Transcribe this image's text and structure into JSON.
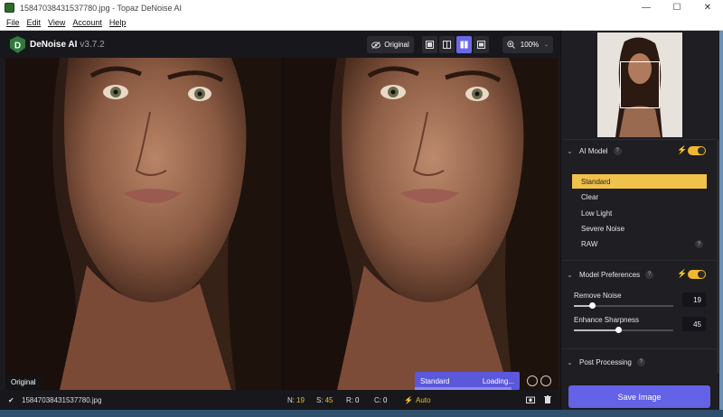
{
  "window": {
    "title": "15847038431537780.jpg - Topaz DeNoise AI",
    "controls": [
      "—",
      "☐",
      "✕"
    ]
  },
  "menu": [
    "File",
    "Edit",
    "View",
    "Account",
    "Help"
  ],
  "header": {
    "app_name": "DeNoise AI",
    "version": "v3.7.2",
    "original_button": "Original",
    "zoom": "100%"
  },
  "preview": {
    "original_label": "Original"
  },
  "processing": {
    "model": "Standard",
    "status": "Loading...",
    "progress": 0.92
  },
  "status": {
    "filename": "15847038431537780.jpg",
    "n_label": "N:",
    "n_value": "19",
    "s_label": "S:",
    "s_value": "45",
    "r_label": "R:",
    "r_value": "0",
    "c_label": "C:",
    "c_value": "0",
    "mode": "Auto"
  },
  "sidebar": {
    "ai_model": {
      "title": "AI Model",
      "items": [
        "Standard",
        "Clear",
        "Low Light",
        "Severe Noise",
        "RAW"
      ],
      "selected": "Standard"
    },
    "model_prefs": {
      "title": "Model Preferences",
      "remove_noise_label": "Remove Noise",
      "remove_noise_value": "19",
      "remove_noise_level": 0.19,
      "enhance_sharpness_label": "Enhance Sharpness",
      "enhance_sharpness_value": "45",
      "enhance_sharpness_level": 0.45
    },
    "post_processing": {
      "title": "Post Processing"
    },
    "save_label": "Save Image"
  },
  "colors": {
    "accent": "#6462e6",
    "highlight": "#f0c14b",
    "toggle": "#f0b92d"
  }
}
